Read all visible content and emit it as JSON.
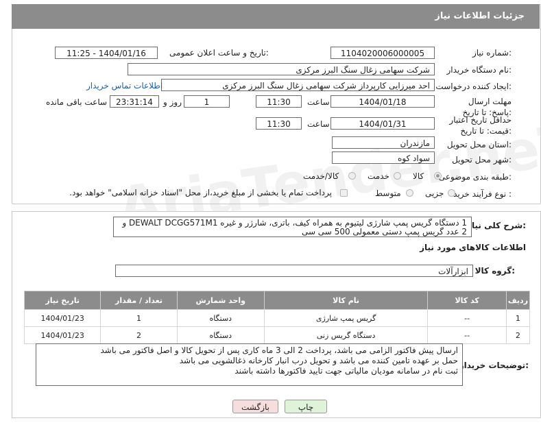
{
  "header": {
    "title": "جزئیات اطلاعات نیاز"
  },
  "fields": {
    "need_number_label": "شماره نیاز:",
    "need_number": "1104020006000005",
    "announce_label": "تاریخ و ساعت اعلان عمومی:",
    "announce_value": "1404/01/16 - 11:25",
    "buyer_org_label": "نام دستگاه خریدار:",
    "buyer_org": "شرکت سهامی زغال سنگ البرز مرکزی",
    "creator_label": "ایجاد کننده درخواست:",
    "creator": "احد میرزایی کارپرداز شرکت سهامی زغال سنگ البرز مرکزی",
    "contact_link": "اطلاعات تماس خریدار",
    "reply_deadline_label": "مهلت ارسال پاسخ: تا تاریخ:",
    "reply_date": "1404/01/18",
    "time_word": "ساعت",
    "reply_time": "11:30",
    "days_value": "1",
    "days_word": "روز و",
    "remaining_time": "23:31:14",
    "remaining_word": "ساعت باقی مانده",
    "price_validity_label": "حداقل تاریخ اعتبار قیمت: تا تاریخ:",
    "price_date": "1404/01/31",
    "price_time": "11:30",
    "province_label": "استان محل تحویل:",
    "province": "مازندران",
    "city_label": "شهر محل تحویل:",
    "city": "سواد کوه",
    "category_label": "طبقه بندی موضوعی:",
    "category_options": [
      "کالا",
      "خدمت",
      "کالا/خدمت"
    ],
    "category_selected": "کالا",
    "purchase_type_label": "نوع فرآیند خرید :",
    "purchase_options": [
      "جزیی",
      "متوسط"
    ],
    "purchase_note": "پرداخت تمام یا بخشی از مبلغ خرید،از محل \"اسناد خزانه اسلامی\" خواهد بود."
  },
  "description": {
    "label": "شرح کلی نیاز:",
    "text": "1 دستگاه گریس پمپ شارژی لیتیوم به همراه کیف، باتری، شارژر و غیره  DEWALT DCGG571M1 و 2 عدد گریس پمپ دستی معمولی 500 سی سی"
  },
  "goods": {
    "section_title": "اطلاعات کالاهای مورد نیاز",
    "group_label": "گروه کالا:",
    "group_value": "ابزارآلات",
    "columns": [
      "ردیف",
      "کد کالا",
      "نام کالا",
      "واحد شمارش",
      "تعداد / مقدار",
      "تاریخ نیاز"
    ],
    "rows": [
      [
        "1",
        "--",
        "گریس پمپ شارژی",
        "دستگاه",
        "1",
        "1404/01/23"
      ],
      [
        "2",
        "--",
        "دستگاه گریس زنی",
        "دستگاه",
        "2",
        "1404/01/23"
      ]
    ]
  },
  "buyer_notes": {
    "label": "توضیحات خریدار:",
    "lines": [
      "ارسال پیش فاکتور الزامی می باشد، پرداخت 2 الی 3 ماه کاری پس از تحویل کالا و اصل فاکتور می باشد",
      "حمل بر عهده تامین کننده می باشد و تحویل درب انبار کارخانه ذغالشویی می باشد",
      "ثبت نام در سامانه مودیان مالیاتی جهت تایید فاکتورها داشته باشند"
    ]
  },
  "buttons": {
    "print": "چاپ",
    "back": "بازگشت"
  },
  "watermark": "AriaTender.neT",
  "colors": {
    "header_bg": "#8c8c8c",
    "link": "#1b5fa8",
    "print_btn": "#dff3d8",
    "back_btn": "#f6dede"
  }
}
